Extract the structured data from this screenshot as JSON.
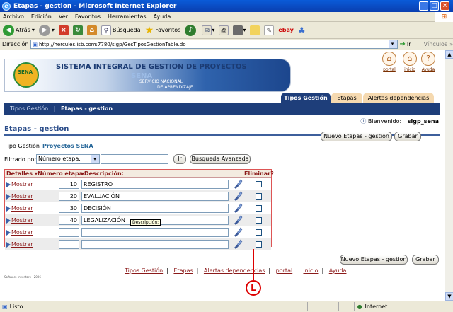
{
  "window": {
    "title": "Etapas - gestion - Microsoft Internet Explorer"
  },
  "menu": [
    "Archivo",
    "Edición",
    "Ver",
    "Favoritos",
    "Herramientas",
    "Ayuda"
  ],
  "toolbar": {
    "back": "Atrás",
    "search": "Búsqueda",
    "favorites": "Favoritos"
  },
  "address": {
    "label": "Dirección",
    "url": "http://hercules.isb.com:7780/sigp/GesTiposGestionTable.do",
    "go": "Ir",
    "links": "Vínculos"
  },
  "banner": {
    "title": "SISTEMA INTEGRAL DE GESTION DE PROYECTOS",
    "logo_text": "SENA",
    "sena": "SENA",
    "servicio": "SERVICIO NACIONAL",
    "aprendizaje": "DE APRENDIZAJE",
    "portal": "portal",
    "inicio": "inicio",
    "ayuda": "Ayuda"
  },
  "tabs": [
    {
      "label": "Tipos Gestión"
    },
    {
      "label": "Etapas"
    },
    {
      "label": "Alertas dependencias"
    }
  ],
  "breadcrumb": {
    "item1": "Tipos Gestión",
    "sep": "|",
    "item2": "Etapas - gestion"
  },
  "welcome": {
    "label": "Bienvenido:",
    "user": "sigp_sena"
  },
  "page": {
    "title": "Etapas - gestion"
  },
  "buttons": {
    "nuevo": "Nuevo Etapas - gestion",
    "grabar": "Grabar",
    "ir": "Ir",
    "busqueda": "Búsqueda Avanzada"
  },
  "tipo": {
    "label": "Tipo Gestión",
    "value": "Proyectos SENA"
  },
  "filter": {
    "label": "Filtrado por",
    "selected": "Número etapa:"
  },
  "table": {
    "headers": {
      "detalles": "Detalles",
      "numero": "▾Número etapa:",
      "descripcion": "▾Descripción:",
      "eliminar": "Eliminar?"
    },
    "show_label": "Mostrar",
    "rows": [
      {
        "numero": "10",
        "descripcion": "REGISTRO"
      },
      {
        "numero": "20",
        "descripcion": "EVALUACIÓN"
      },
      {
        "numero": "30",
        "descripcion": "DECISIÓN"
      },
      {
        "numero": "40",
        "descripcion": "LEGALIZACIÓN"
      },
      {
        "numero": "",
        "descripcion": ""
      },
      {
        "numero": "",
        "descripcion": ""
      }
    ]
  },
  "tooltip": "Descripción:",
  "footer": {
    "links": [
      "Tipos Gestión",
      "Etapas",
      "Alertas dependencias",
      "portal",
      "inicio",
      "Ayuda"
    ],
    "copyright": "Software Inventors - 2006"
  },
  "annotation": "L",
  "status": {
    "left": "Listo",
    "zone": "Internet"
  },
  "colors": {
    "accent": "#1e3e7a",
    "tab_active": "#1e3e7a",
    "tab_inactive": "#f5d9b0",
    "link": "#8b1a1a",
    "annotation": "#dd0000"
  }
}
